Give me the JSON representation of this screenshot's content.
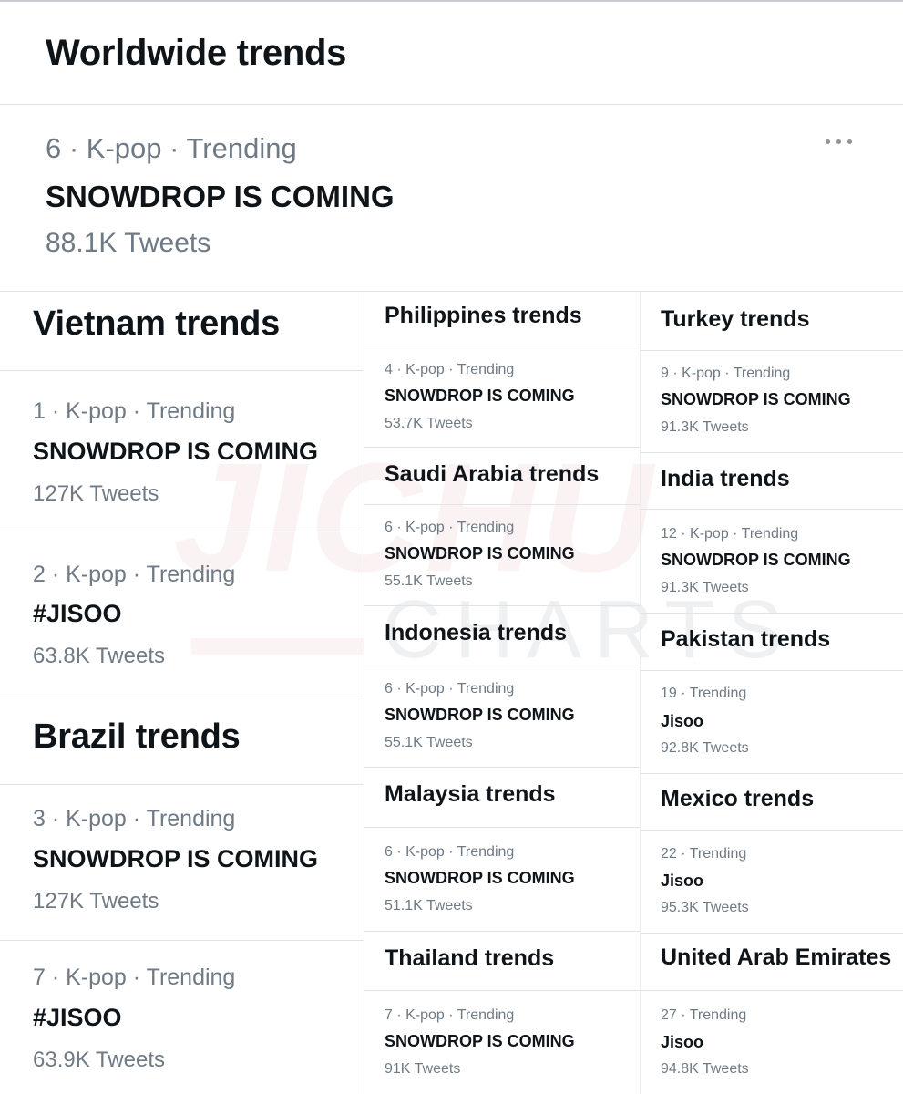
{
  "worldwide": {
    "title": "Worldwide trends",
    "item": {
      "meta": "6 · K-pop · Trending",
      "name": "SNOWDROP IS COMING",
      "count": "88.1K Tweets",
      "more_icon": "more-horizontal-icon"
    }
  },
  "vietnam": {
    "title": "Vietnam trends",
    "items": [
      {
        "meta": "1 · K-pop · Trending",
        "name": "SNOWDROP IS COMING",
        "count": "127K Tweets"
      },
      {
        "meta": "2 · K-pop · Trending",
        "name": "#JISOO",
        "count": "63.8K Tweets"
      }
    ]
  },
  "brazil": {
    "title": "Brazil trends",
    "items": [
      {
        "meta": "3 · K-pop · Trending",
        "name": "SNOWDROP IS COMING",
        "count": "127K Tweets"
      },
      {
        "meta": "7 · K-pop · Trending",
        "name": "#JISOO",
        "count": "63.9K Tweets"
      }
    ]
  },
  "philippines": {
    "title": "Philippines trends",
    "item": {
      "meta": "4 · K-pop · Trending",
      "name": "SNOWDROP IS COMING",
      "count": "53.7K Tweets"
    }
  },
  "saudi_arabia": {
    "title": "Saudi Arabia trends",
    "item": {
      "meta": "6 · K-pop · Trending",
      "name": "SNOWDROP IS COMING",
      "count": "55.1K Tweets"
    }
  },
  "indonesia": {
    "title": "Indonesia trends",
    "item": {
      "meta": "6 · K-pop · Trending",
      "name": "SNOWDROP IS COMING",
      "count": "55.1K Tweets"
    }
  },
  "malaysia": {
    "title": "Malaysia trends",
    "item": {
      "meta": "6 · K-pop · Trending",
      "name": "SNOWDROP IS COMING",
      "count": "51.1K Tweets"
    }
  },
  "thailand": {
    "title": "Thailand trends",
    "item": {
      "meta": "7 · K-pop · Trending",
      "name": "SNOWDROP IS COMING",
      "count": "91K Tweets"
    }
  },
  "turkey": {
    "title": "Turkey trends",
    "item": {
      "meta": "9 · K-pop · Trending",
      "name": "SNOWDROP IS COMING",
      "count": "91.3K Tweets"
    }
  },
  "india": {
    "title": "India trends",
    "item": {
      "meta": "12 · K-pop · Trending",
      "name": "SNOWDROP IS COMING",
      "count": "91.3K Tweets"
    }
  },
  "pakistan": {
    "title": "Pakistan trends",
    "item": {
      "meta": "19 · Trending",
      "name": "Jisoo",
      "count": "92.8K Tweets"
    }
  },
  "mexico": {
    "title": "Mexico trends",
    "item": {
      "meta": "22 · Trending",
      "name": "Jisoo",
      "count": "95.3K Tweets"
    }
  },
  "uae": {
    "title": "United Arab Emirates",
    "item": {
      "meta": "27 · Trending",
      "name": "Jisoo",
      "count": "94.8K Tweets"
    }
  },
  "watermark": {
    "main": "JICHU",
    "sub": "CHARTS"
  }
}
